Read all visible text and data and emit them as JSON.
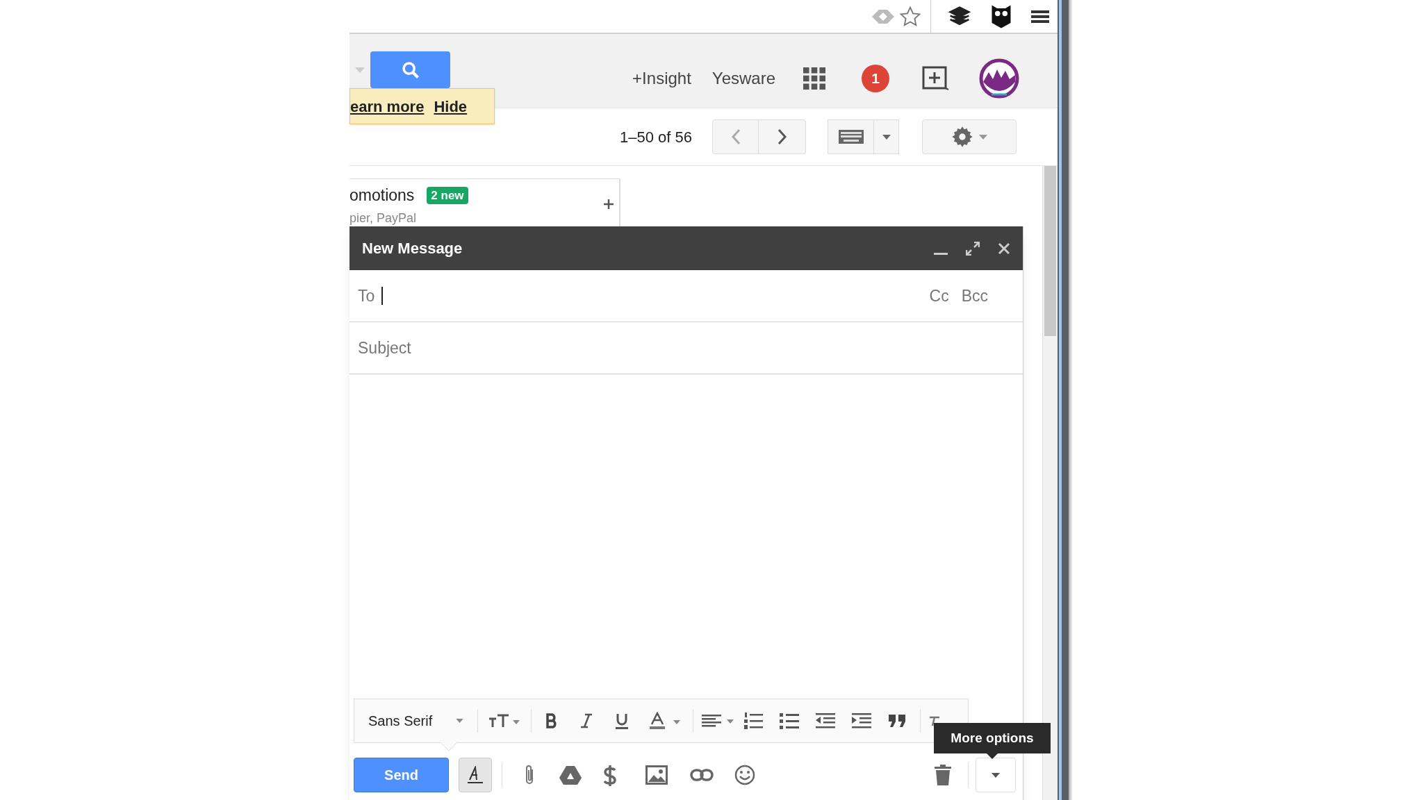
{
  "header_links": [
    "+Insight",
    "Yesware"
  ],
  "notification_count": "1",
  "promo_tooltip": {
    "links": [
      "earn more",
      "Hide"
    ]
  },
  "pagination": "1–50 of 56",
  "category_tab": {
    "label": "omotions",
    "badge": "2 new",
    "snippet": "pier, PayPal"
  },
  "compose": {
    "title": "New Message",
    "to_label": "To",
    "cc": "Cc",
    "bcc": "Bcc",
    "subject_placeholder": "Subject",
    "font": "Sans Serif",
    "send": "Send",
    "formatting_toggle": {
      "pressed": true
    },
    "tooltip": "More options"
  }
}
